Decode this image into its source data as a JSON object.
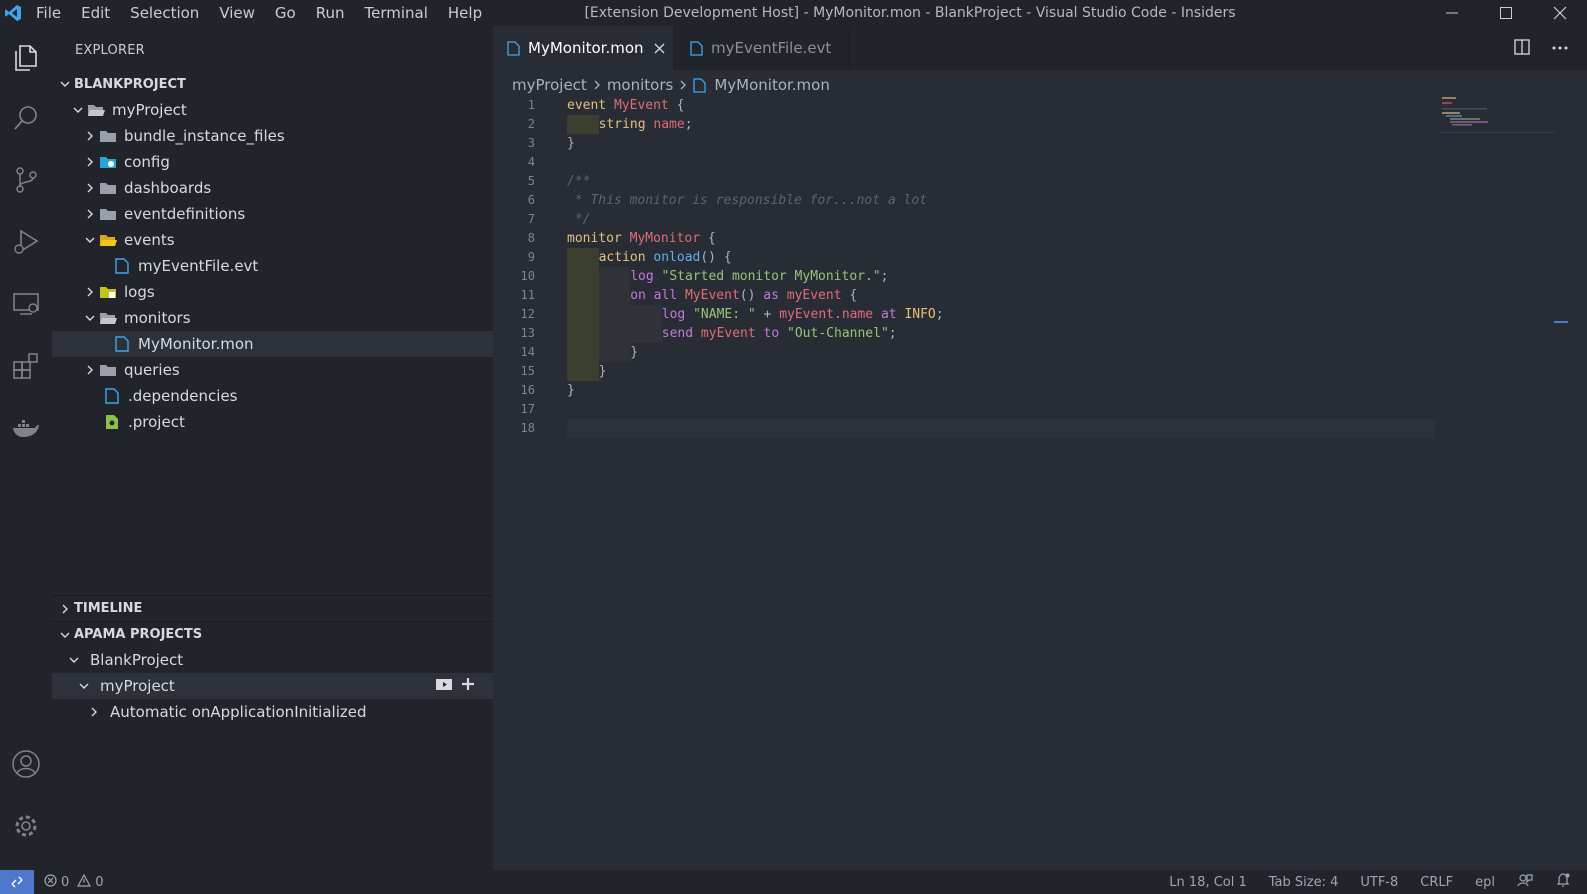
{
  "titlebar": {
    "menu": [
      "File",
      "Edit",
      "Selection",
      "View",
      "Go",
      "Run",
      "Terminal",
      "Help"
    ],
    "window_title": "[Extension Development Host] - MyMonitor.mon - BlankProject - Visual Studio Code - Insiders"
  },
  "sidebar": {
    "title": "EXPLORER",
    "workspace": "BLANKPROJECT",
    "tree": [
      {
        "label": "myProject",
        "kind": "folder-open"
      },
      {
        "label": "bundle_instance_files",
        "kind": "folder"
      },
      {
        "label": "config",
        "kind": "folder-config"
      },
      {
        "label": "dashboards",
        "kind": "folder"
      },
      {
        "label": "eventdefinitions",
        "kind": "folder"
      },
      {
        "label": "events",
        "kind": "folder-open-yellow"
      },
      {
        "label": "myEventFile.evt",
        "kind": "file"
      },
      {
        "label": "logs",
        "kind": "folder-logs"
      },
      {
        "label": "monitors",
        "kind": "folder-open"
      },
      {
        "label": "MyMonitor.mon",
        "kind": "file"
      },
      {
        "label": "queries",
        "kind": "folder"
      },
      {
        "label": ".dependencies",
        "kind": "file"
      },
      {
        "label": ".project",
        "kind": "file-project"
      }
    ],
    "timeline": "TIMELINE",
    "apama": {
      "title": "APAMA PROJECTS",
      "items": [
        "BlankProject",
        "myProject",
        "Automatic onApplicationInitialized"
      ]
    }
  },
  "editor": {
    "tabs": [
      {
        "label": "MyMonitor.mon",
        "active": true
      },
      {
        "label": "myEventFile.evt",
        "active": false
      }
    ],
    "breadcrumb": [
      "myProject",
      "monitors",
      "MyMonitor.mon"
    ],
    "line_numbers": [
      "1",
      "2",
      "3",
      "4",
      "5",
      "6",
      "7",
      "8",
      "9",
      "10",
      "11",
      "12",
      "13",
      "14",
      "15",
      "16",
      "17",
      "18"
    ]
  },
  "statusbar": {
    "errors": "0",
    "warnings": "0",
    "position": "Ln 18, Col 1",
    "tab_size": "Tab Size: 4",
    "encoding": "UTF-8",
    "eol": "CRLF",
    "language": "epl"
  },
  "colors": {
    "accent": "#4d78cc",
    "background": "#282c34",
    "sidebar": "#21252b"
  }
}
